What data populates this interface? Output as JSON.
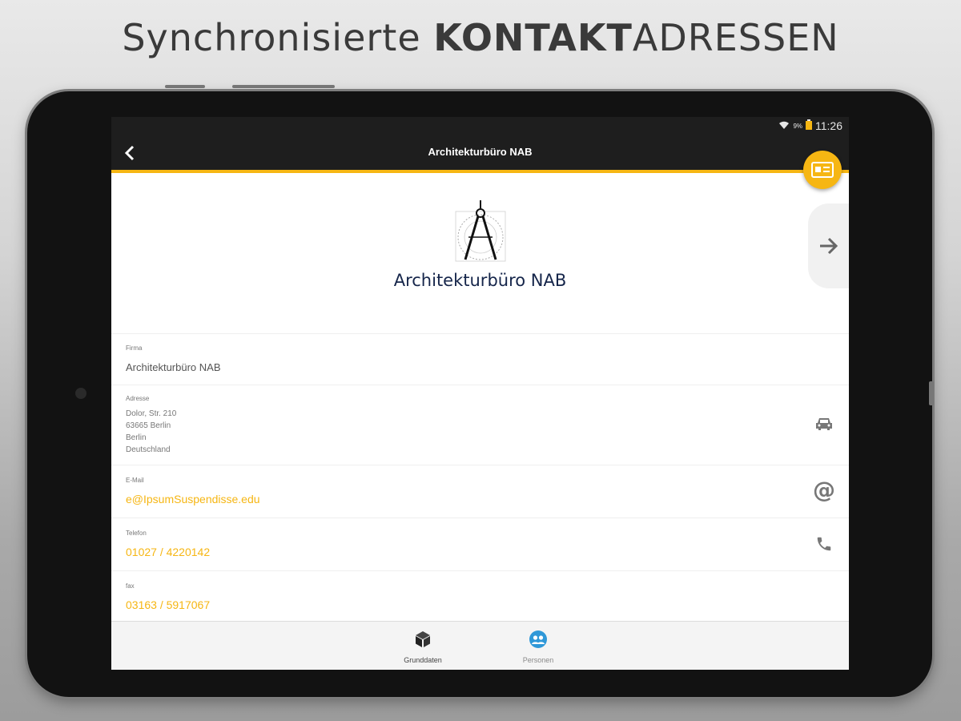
{
  "headline": {
    "light_prefix": "Synchronisierte ",
    "bold_part": "KONTAKT",
    "light_suffix": "ADRESSEN"
  },
  "statusbar": {
    "signal_text": "9%",
    "time": "11:26"
  },
  "appbar": {
    "title": "Architekturbüro NAB",
    "back_icon": "chevron-left-icon",
    "fab_icon": "contact-card-icon"
  },
  "logo": {
    "text": "Architekturbüro NAB",
    "icon": "drafting-compass-logo"
  },
  "fields": {
    "firma": {
      "label": "Firma",
      "value": "Architekturbüro NAB"
    },
    "adresse": {
      "label": "Adresse",
      "lines": [
        "Dolor, Str. 210",
        "63665 Berlin",
        "Berlin",
        "Deutschland"
      ],
      "icon": "car-icon"
    },
    "email": {
      "label": "E-Mail",
      "value": "e@IpsumSuspendisse.edu",
      "icon": "at-icon"
    },
    "telefon": {
      "label": "Telefon",
      "value": "01027 / 4220142",
      "icon": "phone-icon"
    },
    "fax": {
      "label": "fax",
      "value": "03163 / 5917067"
    }
  },
  "bottom_nav": [
    {
      "label": "Grunddaten",
      "icon": "cube-icon",
      "active": true
    },
    {
      "label": "Personen",
      "icon": "people-icon",
      "active": false
    }
  ],
  "colors": {
    "accent": "#f6b613",
    "appbar": "#1e1e1e",
    "logo_text": "#15254a"
  }
}
